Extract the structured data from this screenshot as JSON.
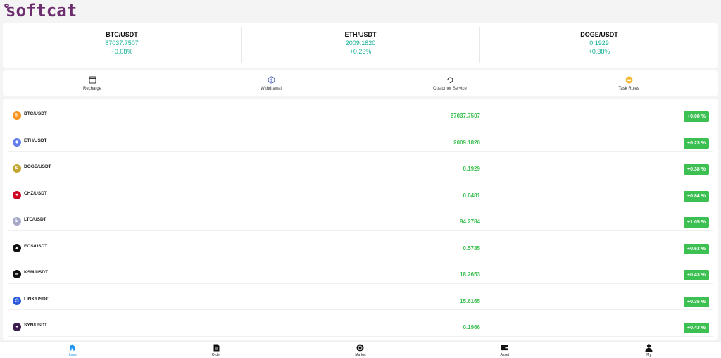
{
  "brand": {
    "logo_text": "softcat",
    "color": "#6c2d6e"
  },
  "tickers": [
    {
      "pair": "BTC/USDT",
      "price": "87037.7507",
      "change": "+0.08%"
    },
    {
      "pair": "ETH/USDT",
      "price": "2009.1820",
      "change": "+0.23%"
    },
    {
      "pair": "DOGE/USDT",
      "price": "0.1929",
      "change": "+0.38%"
    }
  ],
  "actions": [
    {
      "label": "Recharge",
      "icon": "recharge-icon"
    },
    {
      "label": "Withdrawal",
      "icon": "withdrawal-icon"
    },
    {
      "label": "Customer Service",
      "icon": "customer-service-icon"
    },
    {
      "label": "Task Rules",
      "icon": "task-rules-icon"
    }
  ],
  "markets": [
    {
      "symbol": "BTC/USDT",
      "price": "87037.7507",
      "change": "+0.08 %",
      "coin_color": "#f7931a"
    },
    {
      "symbol": "ETH/USDT",
      "price": "2009.1820",
      "change": "+0.23 %",
      "coin_color": "#627eea"
    },
    {
      "symbol": "DOGE/USDT",
      "price": "0.1929",
      "change": "+0.38 %",
      "coin_color": "#c2a633"
    },
    {
      "symbol": "CHZ/USDT",
      "price": "0.0481",
      "change": "+0.84 %",
      "coin_color": "#cd0124"
    },
    {
      "symbol": "LTC/USDT",
      "price": "94.2784",
      "change": "+1.05 %",
      "coin_color": "#a6a9c8"
    },
    {
      "symbol": "EOS/USDT",
      "price": "0.5785",
      "change": "+0.63 %",
      "coin_color": "#111111"
    },
    {
      "symbol": "KSM/USDT",
      "price": "18.2653",
      "change": "+0.43 %",
      "coin_color": "#111111"
    },
    {
      "symbol": "LINK/USDT",
      "price": "15.6165",
      "change": "+0.35 %",
      "coin_color": "#2a5ada"
    },
    {
      "symbol": "SYN/USDT",
      "price": "0.1966",
      "change": "+0.43 %",
      "coin_color": "#3a1d4c"
    }
  ],
  "nav": [
    {
      "label": "Home",
      "icon": "home-icon",
      "active": true
    },
    {
      "label": "Order",
      "icon": "order-icon",
      "active": false
    },
    {
      "label": "Market",
      "icon": "market-icon",
      "active": false
    },
    {
      "label": "Asset",
      "icon": "wallet-icon",
      "active": false
    },
    {
      "label": "My",
      "icon": "user-icon",
      "active": false
    }
  ],
  "colors": {
    "up": "#3cc051",
    "ticker_green": "#13b193",
    "active_nav": "#2196f3"
  }
}
